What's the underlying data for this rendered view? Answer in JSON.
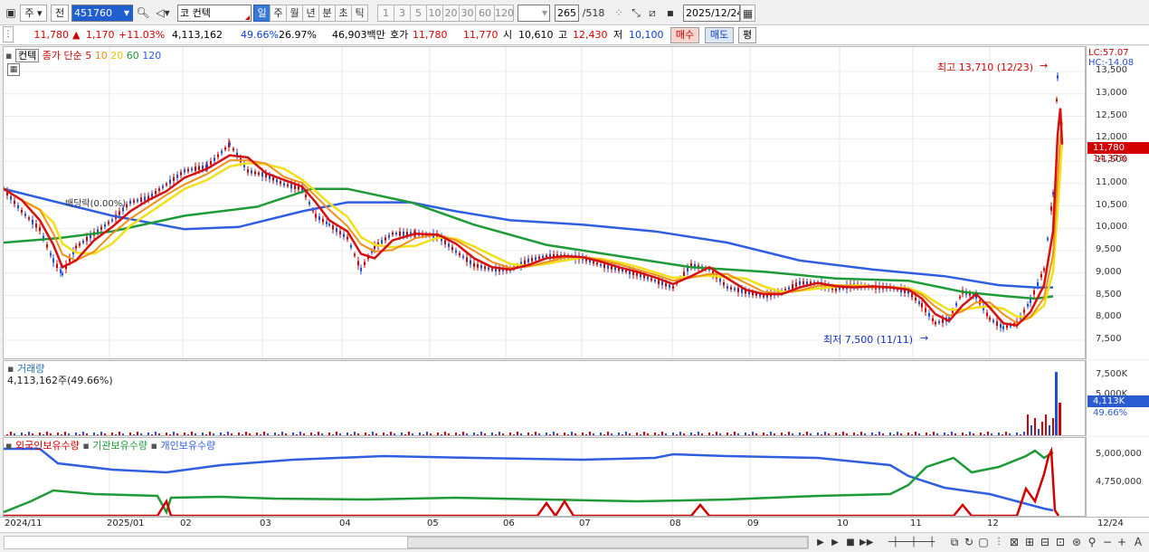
{
  "toolbar": {
    "tab_main": "주",
    "tab_jeon": "전",
    "code": "451760",
    "name_prefix": "코",
    "name": "컨텍",
    "periods": [
      "일",
      "주",
      "월",
      "년",
      "분",
      "초",
      "틱"
    ],
    "minutes": [
      "1",
      "3",
      "5",
      "10",
      "20",
      "30",
      "60",
      "120"
    ],
    "count": "265",
    "count_total": "/518",
    "date": "2025/12/24"
  },
  "quote": {
    "price": "11,780",
    "up_mark": "▲",
    "change": "1,170",
    "change_pct": "+11.03%",
    "volume": "4,113,162",
    "vol_ratio": "49.66%",
    "turnover": "26.97%",
    "amount": "46,903백만",
    "ask_label": "호가",
    "ask": "11,780",
    "bid": "11,770",
    "open_label": "시",
    "open": "10,610",
    "high_label": "고",
    "high": "12,430",
    "low_label": "저",
    "low": "10,100",
    "buy_label": "매수",
    "sell_label": "매도",
    "avg_label": "평"
  },
  "price_panel": {
    "stock": "컨텍",
    "legend_prefix": "종가 단순",
    "ma_periods": [
      "5",
      "10",
      "20",
      "60",
      "120"
    ],
    "ma_colors": [
      "#d41010",
      "#f0901b",
      "#f0e01a",
      "#1f9a38",
      "#2f5fe0"
    ],
    "lc_text": "LC:57.07",
    "hc_text": "HC:-14.08",
    "y_labels": [
      "13,500",
      "13,000",
      "12,500",
      "12,000",
      "11,500",
      "11,000",
      "10,500",
      "10,000",
      "9,500",
      "9,000",
      "8,500",
      "8,000",
      "7,500"
    ],
    "current_price_tag": "11,780",
    "current_pct": "14.37%",
    "high_annotation": "최고 13,710 (12/23)",
    "low_annotation": "최저 7,500 (11/11)",
    "div_annotation": "배당락(0.00%)"
  },
  "volume_panel": {
    "title": "거래량",
    "value": "4,113,162주(49.66%)",
    "y_labels": [
      "7,500K",
      "5,000K"
    ],
    "current": "4,113K",
    "current_pct": "49.66%"
  },
  "holding_panel": {
    "foreign": "외국인보유수량",
    "institution": "기관보유수량",
    "individual": "개인보유수량",
    "y_labels": [
      "5,000,000",
      "4,750,000"
    ]
  },
  "x_axis": [
    "2024/11",
    "2025/01",
    "02",
    "03",
    "04",
    "05",
    "06",
    "07",
    "08",
    "09",
    "10",
    "11",
    "12"
  ],
  "x_axis_right": "12/24"
}
